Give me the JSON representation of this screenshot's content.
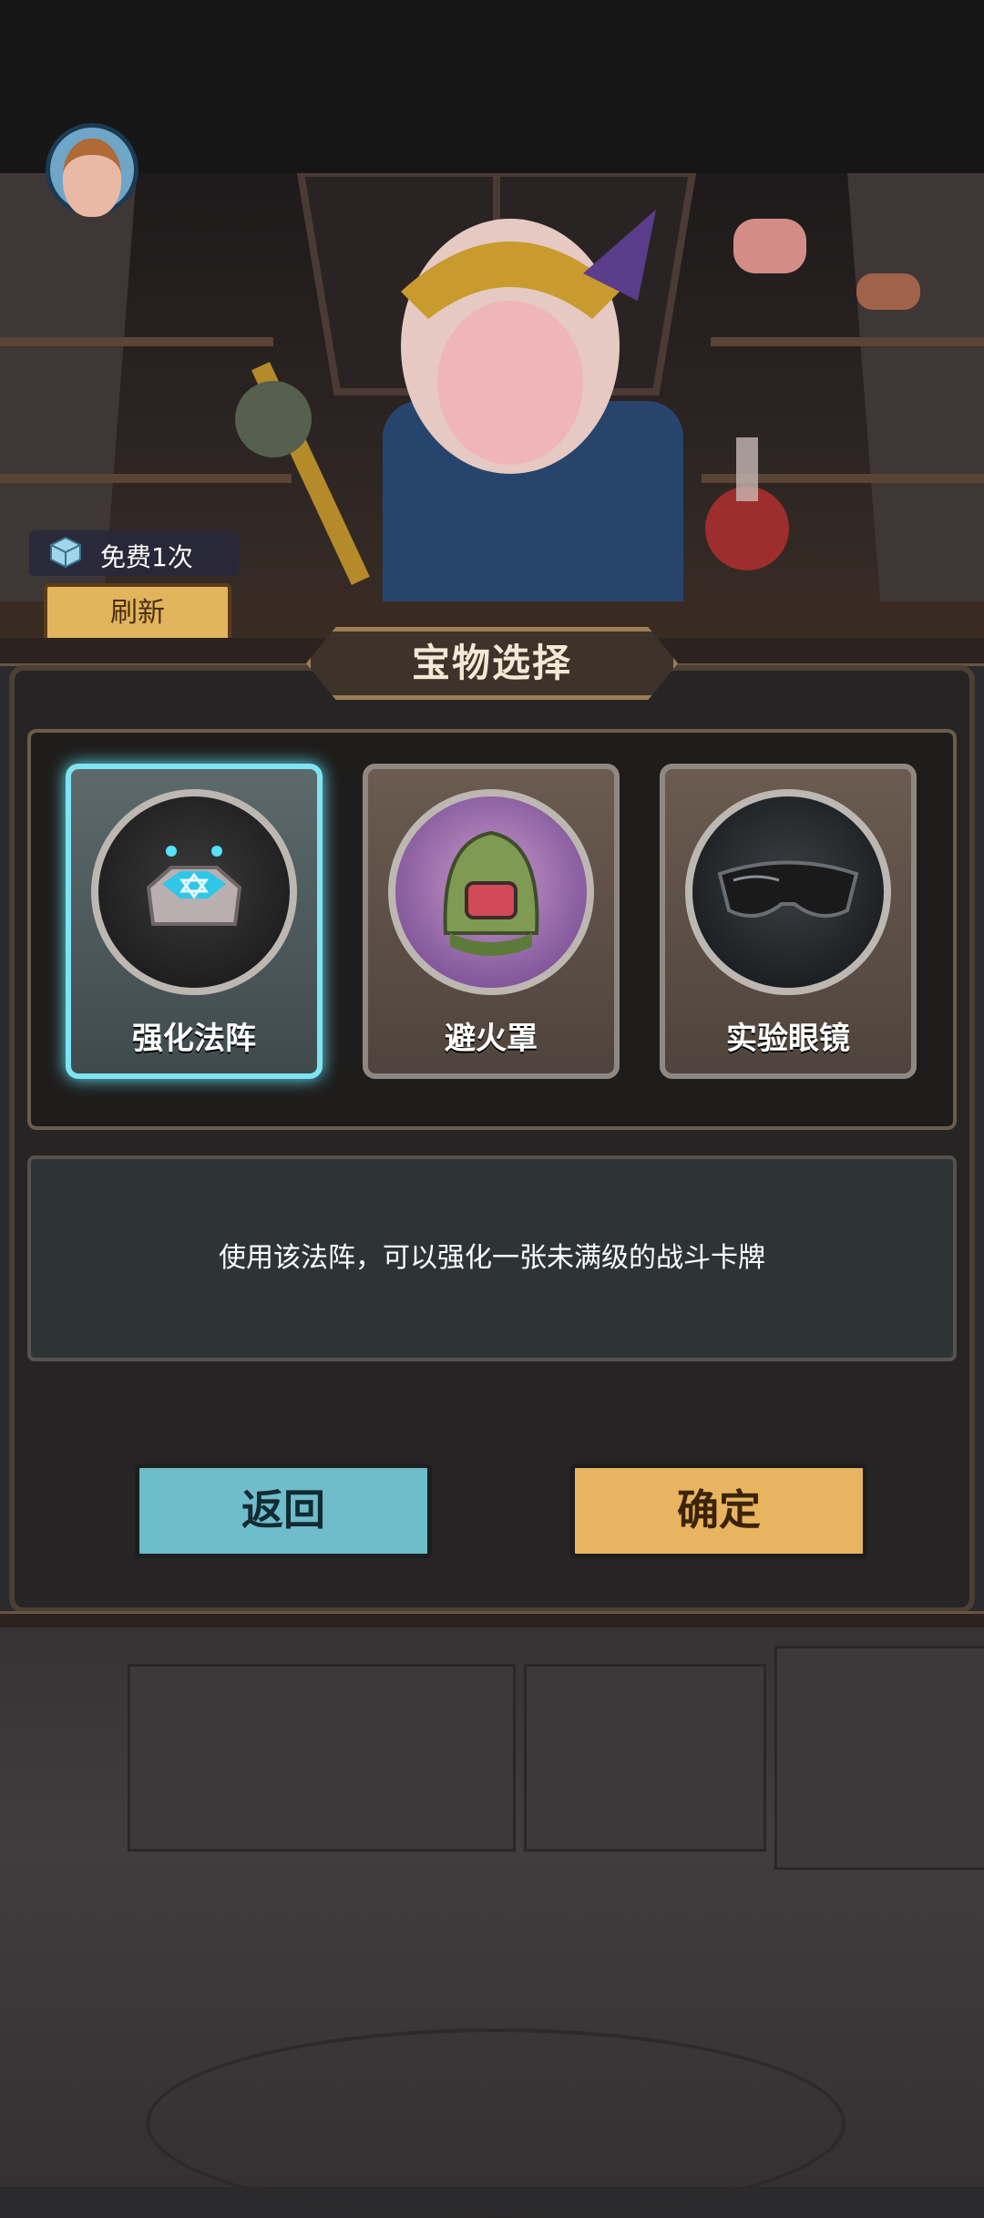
{
  "header": {
    "avatar_icon": "player-avatar-icon"
  },
  "shop": {
    "free_label": "免费1次",
    "refresh_label": "刷新",
    "merchant_icon": "queen-merchant-character"
  },
  "dialog": {
    "title": "宝物选择",
    "items": [
      {
        "name": "强化法阵",
        "icon": "magic-array-icon",
        "selected": true
      },
      {
        "name": "避火罩",
        "icon": "fire-hood-icon",
        "selected": false
      },
      {
        "name": "实验眼镜",
        "icon": "lab-goggles-icon",
        "selected": false
      }
    ],
    "description": "使用该法阵，可以强化一张未满级的战斗卡牌",
    "back_label": "返回",
    "confirm_label": "确定"
  },
  "colors": {
    "accent_cyan": "#7fe4f2",
    "button_blue": "#6fbccb",
    "button_gold": "#e9b45f"
  }
}
